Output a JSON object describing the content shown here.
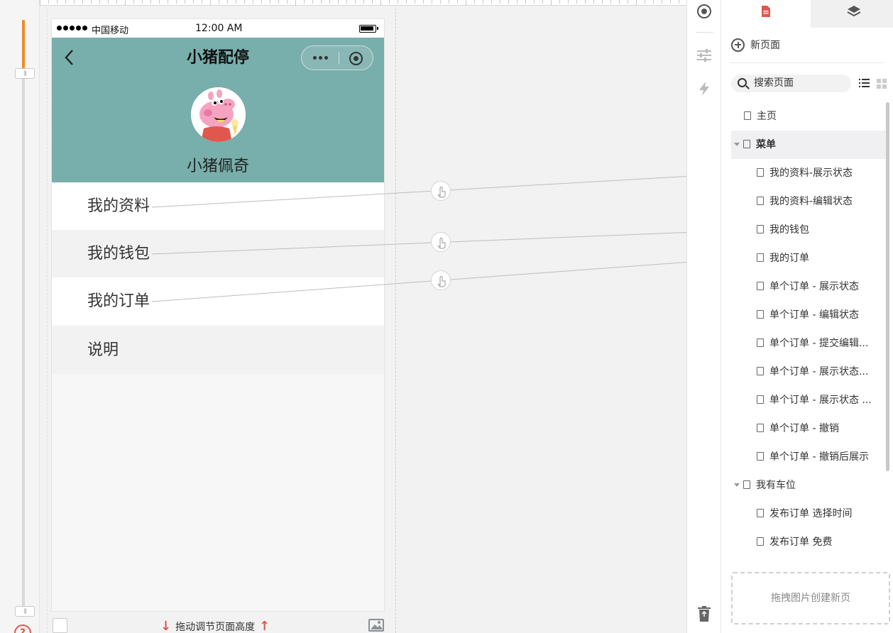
{
  "statusbar": {
    "carrier": "中国移动",
    "time": "12:00 AM"
  },
  "nav": {
    "title": "小猪配停"
  },
  "profile": {
    "name": "小猪佩奇"
  },
  "menu": [
    {
      "label": "我的资料"
    },
    {
      "label": "我的钱包"
    },
    {
      "label": "我的订单"
    },
    {
      "label": "说明"
    }
  ],
  "footer": {
    "drag_hint": "拖动调节页面高度"
  },
  "panel": {
    "new_page": "新页面",
    "search_placeholder": "搜索页面",
    "drop_zone": "拖拽图片创建新页"
  },
  "tree": [
    {
      "label": "主页",
      "level": 0,
      "caret": false
    },
    {
      "label": "菜单",
      "level": 0,
      "caret": true,
      "selected": true
    },
    {
      "label": "我的资料-展示状态",
      "level": 1
    },
    {
      "label": "我的资料-编辑状态",
      "level": 1
    },
    {
      "label": "我的钱包",
      "level": 1
    },
    {
      "label": "我的订单",
      "level": 1
    },
    {
      "label": "单个订单 - 展示状态",
      "level": 1
    },
    {
      "label": "单个订单 - 编辑状态",
      "level": 1
    },
    {
      "label": "单个订单 - 提交编辑...",
      "level": 1
    },
    {
      "label": "单个订单 - 展示状态...",
      "level": 1
    },
    {
      "label": "单个订单 - 展示状态 ...",
      "level": 1
    },
    {
      "label": "单个订单 - 撤销",
      "level": 1
    },
    {
      "label": "单个订单 - 撤销后展示",
      "level": 1
    },
    {
      "label": "我有车位",
      "level": 0,
      "caret": true
    },
    {
      "label": "发布订单 选择时间",
      "level": 1
    },
    {
      "label": "发布订单 免费",
      "level": 1
    }
  ],
  "colors": {
    "header_bg": "#78aeab",
    "accent_orange": "#f08a24",
    "accent_red": "#e0574e"
  },
  "icons": [
    "back-arrow-icon",
    "more-dots-icon",
    "target-icon",
    "help-icon",
    "image-icon",
    "pages-icon",
    "layers-icon",
    "settings-icon",
    "sliders-icon",
    "lightning-icon",
    "recycle-bin-icon",
    "search-icon",
    "list-view-icon",
    "grid-view-icon",
    "document-icon",
    "hand-pointer-icon"
  ]
}
